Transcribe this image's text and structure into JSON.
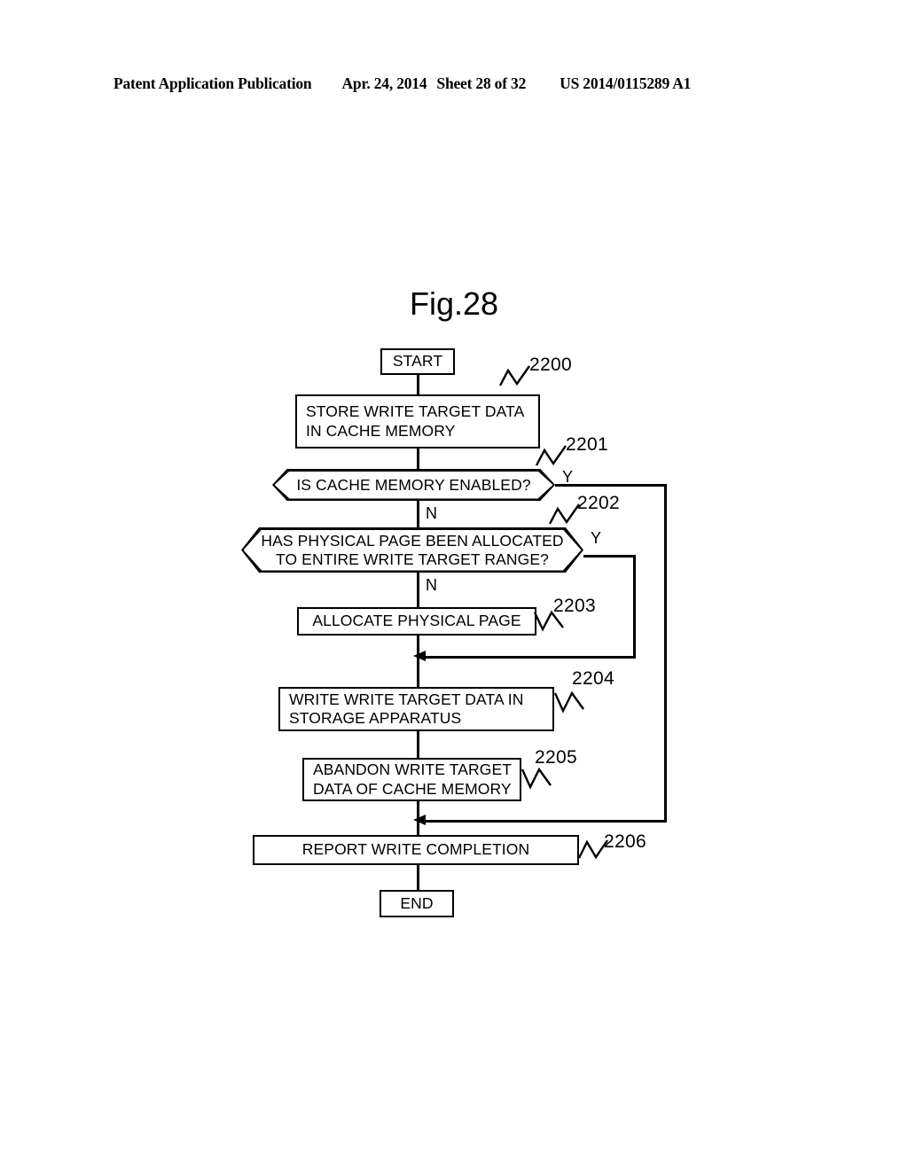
{
  "header": {
    "publication": "Patent Application Publication",
    "date": "Apr. 24, 2014",
    "sheet": "Sheet 28 of 32",
    "patent_number": "US 2014/0115289 A1"
  },
  "figure": {
    "title": "Fig.28",
    "nodes": {
      "start": "START",
      "store_cache": "STORE WRITE TARGET DATA\nIN CACHE MEMORY",
      "cache_enabled": "IS CACHE MEMORY ENABLED?",
      "page_allocated": "HAS PHYSICAL PAGE BEEN ALLOCATED\nTO ENTIRE WRITE TARGET RANGE?",
      "allocate_page": "ALLOCATE PHYSICAL PAGE",
      "write_storage": "WRITE WRITE TARGET DATA IN\nSTORAGE APPARATUS",
      "abandon_cache": "ABANDON WRITE TARGET\nDATA OF CACHE MEMORY",
      "report_completion": "REPORT WRITE COMPLETION",
      "end": "END"
    },
    "branch_labels": {
      "cache_enabled_yes": "Y",
      "cache_enabled_no": "N",
      "page_allocated_yes": "Y",
      "page_allocated_no": "N"
    },
    "reference_numerals": {
      "start": "2200",
      "store_cache": "2201",
      "cache_enabled": "2202",
      "allocate_page": "2203",
      "write_storage": "2204",
      "abandon_cache": "2205",
      "report_completion": "2206"
    }
  },
  "colors": {
    "ink": "#000000",
    "paper": "#ffffff"
  }
}
